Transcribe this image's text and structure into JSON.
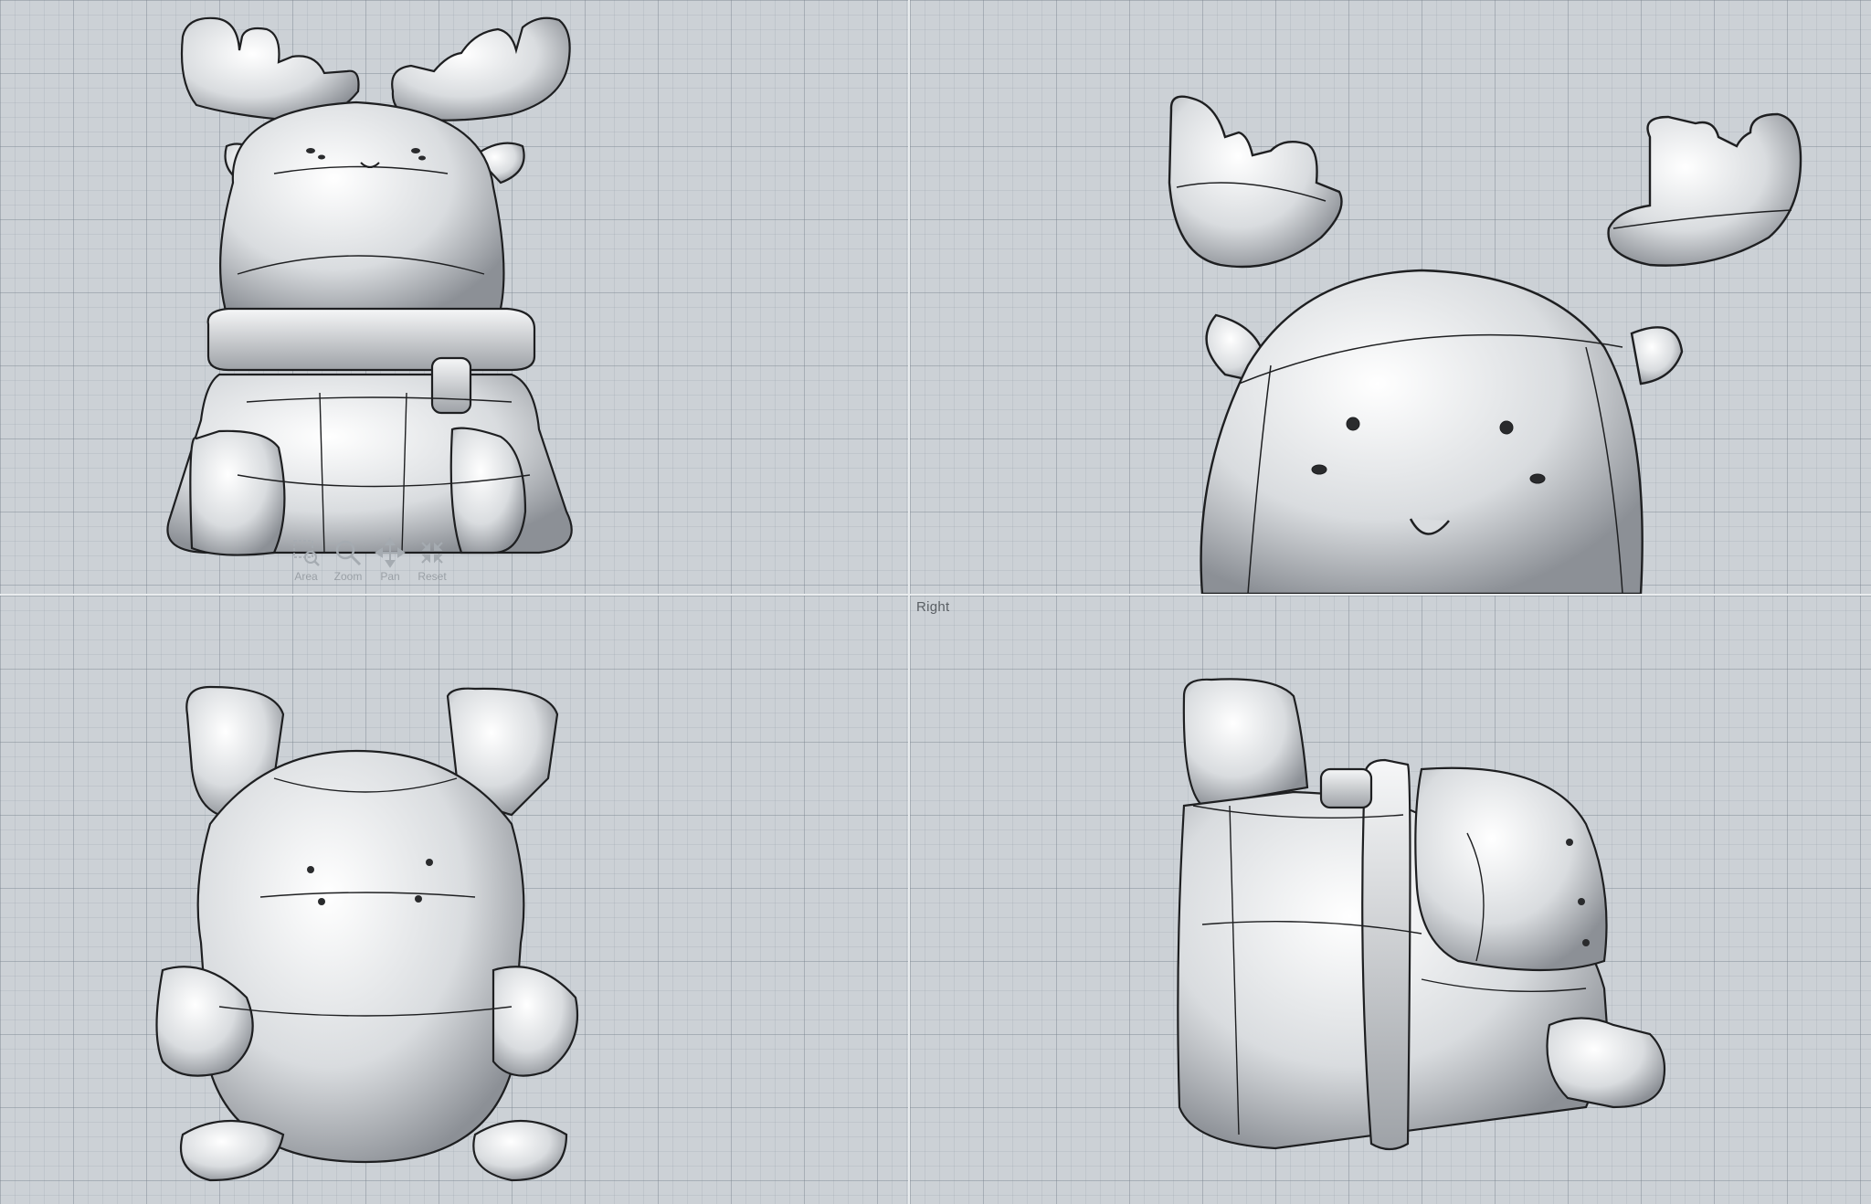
{
  "viewports": [
    {
      "id": "top-left",
      "title": ""
    },
    {
      "id": "top-right",
      "title": ""
    },
    {
      "id": "bottom-left",
      "title": ""
    },
    {
      "id": "bottom-right",
      "title": "Right"
    }
  ],
  "navigation": {
    "area_label": "Area",
    "zoom_label": "Zoom",
    "pan_label": "Pan",
    "reset_label": "Reset"
  },
  "icons": {
    "area": "area-zoom-icon",
    "zoom": "magnifier-icon",
    "pan": "pan-arrows-icon",
    "reset": "reset-arrows-icon"
  },
  "colors": {
    "viewport_bg": "#ccd1d6",
    "model_fill": "#e6e8ea",
    "model_edge": "#1e1f21"
  }
}
